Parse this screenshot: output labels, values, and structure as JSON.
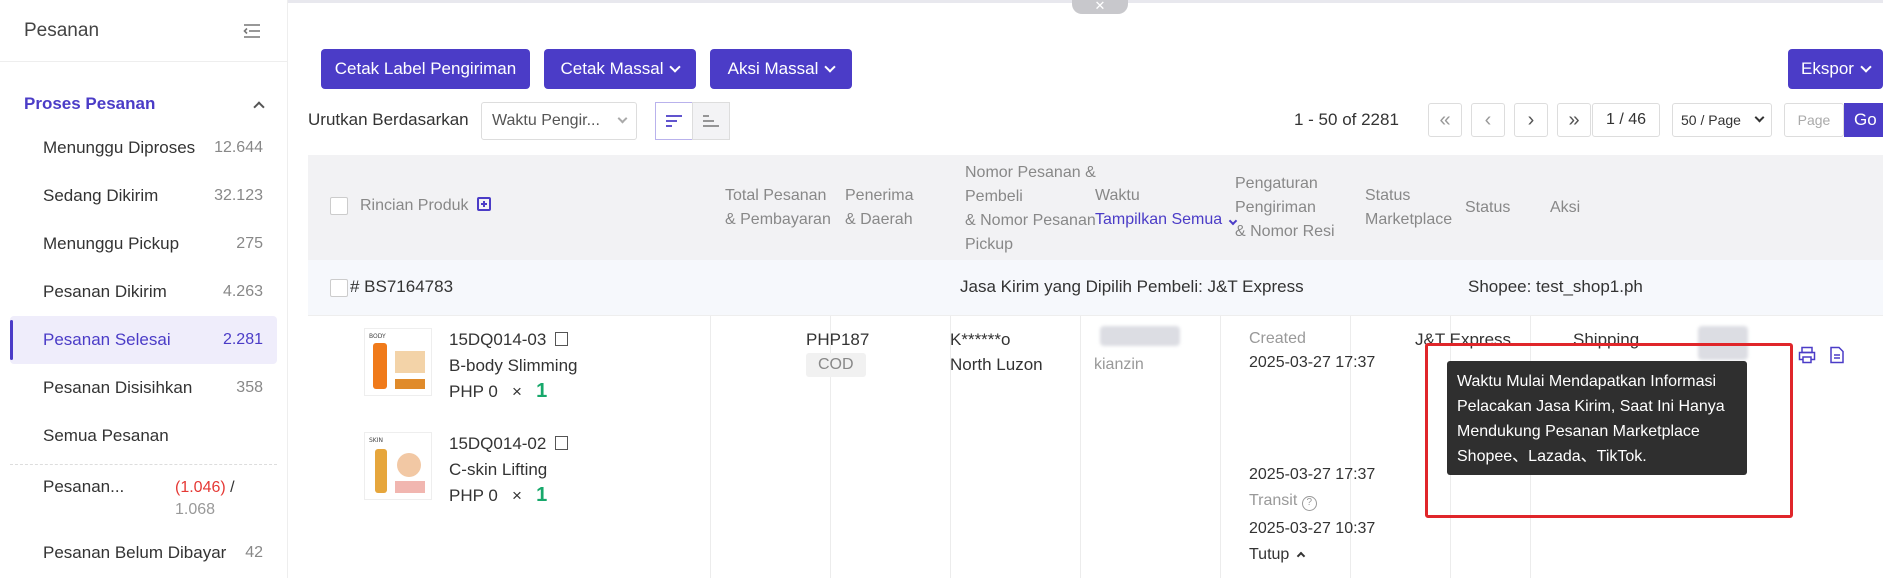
{
  "sidebar": {
    "title": "Pesanan",
    "section": "Proses Pesanan",
    "items": [
      {
        "label": "Menunggu Diproses",
        "count": "12.644"
      },
      {
        "label": "Sedang Dikirim",
        "count": "32.123"
      },
      {
        "label": "Menunggu Pickup",
        "count": "275"
      },
      {
        "label": "Pesanan Dikirim",
        "count": "4.263"
      },
      {
        "label": "Pesanan Selesai",
        "count": "2.281"
      },
      {
        "label": "Pesanan Disisihkan",
        "count": "358"
      },
      {
        "label": "Semua Pesanan",
        "count": ""
      }
    ],
    "extra_item": {
      "label": "Pesanan...",
      "count_red": "(1.046)",
      "count_sep": " /",
      "count_total": "1.068"
    },
    "unpaid_item": {
      "label": "Pesanan Belum Dibayar",
      "count": "42"
    }
  },
  "toolbar": {
    "print_label": "Cetak Label Pengiriman",
    "bulk_print": "Cetak Massal",
    "bulk_action": "Aksi Massal",
    "export": "Ekspor"
  },
  "sort": {
    "label": "Urutkan Berdasarkan",
    "selected": "Waktu Pengir..."
  },
  "pager": {
    "range": "1 - 50 of 2281",
    "page_input": "1 / 46",
    "page_size": "50 / Page",
    "goto_placeholder": "Page",
    "go": "Go"
  },
  "table": {
    "headers": {
      "product": "Rincian Produk",
      "total_l1": "Total Pesanan",
      "total_l2": "& Pembayaran",
      "recipient_l1": "Penerima",
      "recipient_l2": "& Daerah",
      "order_l1": "Nomor Pesanan &",
      "order_l2": "Pembeli",
      "order_l3": "& Nomor Pesanan",
      "order_l4": "Pickup",
      "time_l1": "Waktu",
      "time_l2": "Tampilkan Semua",
      "ship_l1": "Pengaturan",
      "ship_l2": "Pengiriman",
      "ship_l3": "& Nomor Resi",
      "mstatus_l1": "Status",
      "mstatus_l2": "Marketplace",
      "status": "Status",
      "action": "Aksi"
    }
  },
  "order": {
    "number": "# BS7164783",
    "courier_note": "Jasa Kirim yang Dipilih Pembeli: J&T Express",
    "shop": "Shopee: test_shop1.ph",
    "products": [
      {
        "sku": "15DQ014-03",
        "name": "B-body Slimming",
        "price": "PHP 0",
        "times": "×",
        "qty": "1"
      },
      {
        "sku": "15DQ014-02",
        "name": "C-skin Lifting",
        "price": "PHP 0",
        "times": "×",
        "qty": "1"
      }
    ],
    "total": "PHP187",
    "payment": "COD",
    "recipient": "K******o",
    "region": "North Luzon",
    "buyer_partial": "kianzin",
    "created_label": "Created",
    "created_time": "2025-03-27 17:37",
    "time2": "2025-03-27 17:37",
    "transit_label": "Transit",
    "transit_time": "2025-03-27 10:37",
    "collapse": "Tutup",
    "shipping": "J&T Express",
    "marketplace_status": "Shipping"
  },
  "tooltip": {
    "text": "Waktu Mulai Mendapatkan Informasi Pelacakan Jasa Kirim, Saat Ini Hanya Mendukung Pesanan Marketplace Shopee、Lazada、TikTok."
  },
  "colors": {
    "accent": "#4b3cc7",
    "highlight_box": "#e0262a",
    "qty": "#17a86b"
  }
}
